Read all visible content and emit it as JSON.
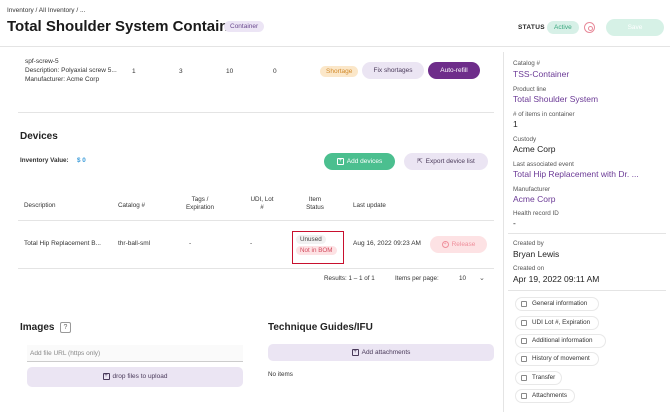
{
  "breadcrumb": "Inventory / All Inventory / ...",
  "title": "Total Shoulder System Container",
  "type_tag": "Container",
  "status": {
    "label": "STATUS",
    "value": "Active"
  },
  "save_label": "Save",
  "component_row": {
    "name": "spf-screw-5",
    "description": "Description: Polyaxial screw 5...",
    "manufacturer": "Manufacturer: Acme Corp",
    "col1": "1",
    "col2": "3",
    "col3": "10",
    "col4": "0",
    "status": "Shortage",
    "fix_label": "Fix shortages",
    "refill_label": "Auto-refill"
  },
  "devices": {
    "heading": "Devices",
    "inventory_value_label": "Inventory Value:",
    "inventory_value": "$ 0",
    "add_label": "Add devices",
    "export_label": "Export device list",
    "columns": {
      "description": "Description",
      "catalog": "Catalog #",
      "tags_line1": "Tags /",
      "tags_line2": "Expiration",
      "udi_line1": "UDI, Lot",
      "udi_line2": "#",
      "item_line1": "Item",
      "item_line2": "Status",
      "last_update": "Last update"
    },
    "row": {
      "description": "Total Hip Replacement B...",
      "catalog": "thr-ball-sml",
      "tags": "-",
      "udi": "-",
      "status1": "Unused",
      "status2": "Not in BOM",
      "last_update": "Aug 16, 2022 09:23 AM",
      "release_label": "Release"
    },
    "results": "Results: 1 – 1 of 1",
    "items_per_page_label": "Items per page:",
    "items_per_page": "10"
  },
  "images": {
    "heading": "Images",
    "help": "?",
    "url_placeholder": "Add file URL (https only)",
    "drop_label": "drop files to upload"
  },
  "guides": {
    "heading": "Technique Guides/IFU",
    "add_label": "Add attachments",
    "empty": "No items"
  },
  "sidebar": {
    "fields": [
      {
        "label": "Catalog #",
        "value": "TSS-Container",
        "accent": true
      },
      {
        "label": "Product line",
        "value": "Total Shoulder System",
        "accent": true
      },
      {
        "label": "# of items in container",
        "value": "1",
        "accent": false
      },
      {
        "label": "Custody",
        "value": "Acme Corp",
        "accent": false
      },
      {
        "label": "Last associated event",
        "value": "Total Hip Replacement with Dr. ...",
        "accent": true
      },
      {
        "label": "Manufacturer",
        "value": "Acme Corp",
        "accent": true
      },
      {
        "label": "Health record ID",
        "value": "-",
        "accent": false
      },
      {
        "label": "Created by",
        "value": "Bryan Lewis",
        "accent": false
      },
      {
        "label": "Created on",
        "value": "Apr 19, 2022 09:11 AM",
        "accent": false
      }
    ],
    "buttons": [
      "General information",
      "UDI Lot #, Expiration",
      "Additional information",
      "History of movement",
      "Transfer",
      "Attachments"
    ]
  },
  "colors": {
    "accent": "#6e2d8a",
    "green": "#4bbf8f",
    "highlight": "#c8102e"
  }
}
